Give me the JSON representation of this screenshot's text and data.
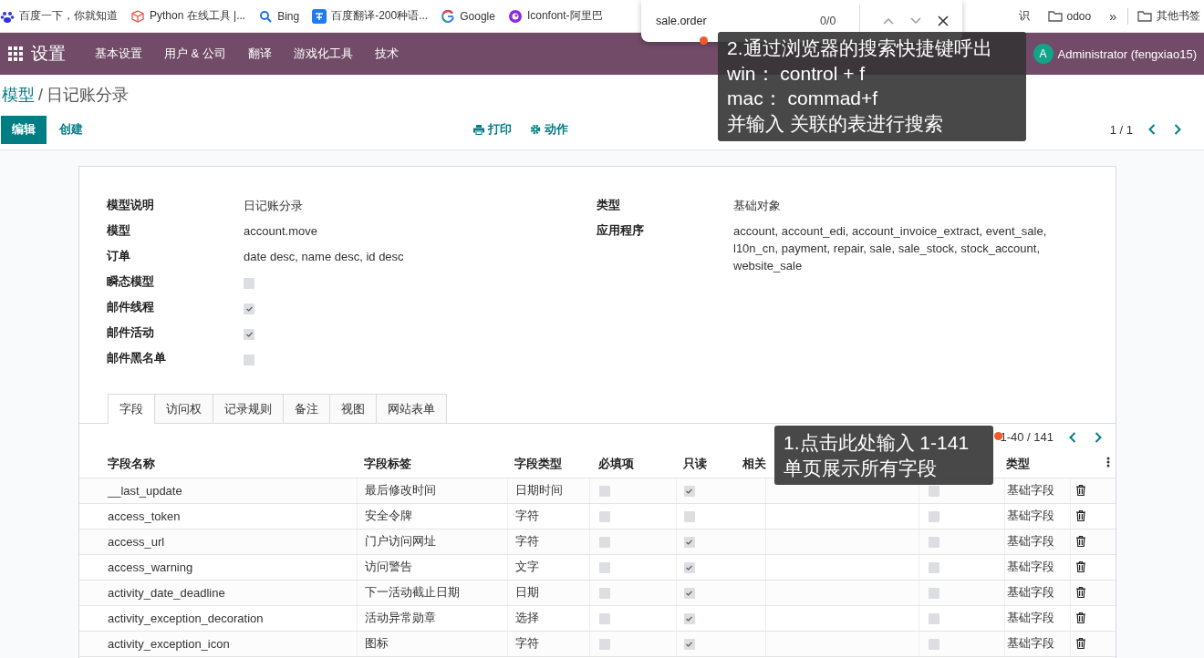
{
  "browser": {
    "bookmarks": [
      {
        "label": "百度一下，你就知道"
      },
      {
        "label": "Python 在线工具 |..."
      },
      {
        "label": "Bing"
      },
      {
        "label": "百度翻译-200种语..."
      },
      {
        "label": "Google"
      },
      {
        "label": "Iconfont-阿里巴"
      }
    ],
    "bookmarks_right": [
      {
        "label": "识"
      },
      {
        "label": "odoo"
      }
    ],
    "overflow": "»",
    "other_bookmarks": "其他书签",
    "find_bar": {
      "value": "sale.order",
      "count": "0/0"
    }
  },
  "navbar": {
    "app": "设置",
    "menus": [
      "基本设置",
      "用户 & 公司",
      "翻译",
      "游戏化工具",
      "技术"
    ],
    "user": {
      "initial": "A",
      "name": "Administrator (fengxiao15)"
    }
  },
  "breadcrumb": {
    "items": [
      "模型",
      "日记账分录"
    ],
    "separator": "/"
  },
  "control_panel": {
    "buttons": [
      "编辑",
      "创建"
    ],
    "actions": [
      "打印",
      "动作"
    ],
    "pager": "1 / 1"
  },
  "form": {
    "left": [
      {
        "label": "模型说明",
        "kind": "text",
        "value": "日记账分录"
      },
      {
        "label": "模型",
        "kind": "text",
        "value": "account.move"
      },
      {
        "label": "订单",
        "kind": "text",
        "value": "date desc, name desc, id desc"
      },
      {
        "label": "瞬态模型",
        "kind": "checkbox",
        "checked": false
      },
      {
        "label": "邮件线程",
        "kind": "checkbox",
        "checked": true
      },
      {
        "label": "邮件活动",
        "kind": "checkbox",
        "checked": true
      },
      {
        "label": "邮件黑名单",
        "kind": "checkbox",
        "checked": false
      }
    ],
    "right": [
      {
        "label": "类型",
        "kind": "text",
        "value": "基础对象"
      },
      {
        "label": "应用程序",
        "kind": "text",
        "value": "account, account_edi, account_invoice_extract, event_sale, l10n_cn, payment, repair, sale, sale_stock, stock_account, website_sale"
      }
    ]
  },
  "tabs": [
    {
      "label": "字段",
      "selected": true
    },
    {
      "label": "访问权",
      "selected": false
    },
    {
      "label": "记录规则",
      "selected": false
    },
    {
      "label": "备注",
      "selected": false
    },
    {
      "label": "视图",
      "selected": false
    },
    {
      "label": "网站表单",
      "selected": false
    }
  ],
  "fields_table": {
    "pager": "1-40 / 141",
    "columns": [
      "字段名称",
      "字段标签",
      "字段类型",
      "必填项",
      "只读",
      "相关",
      "类型"
    ],
    "rows": [
      {
        "name": "__last_update",
        "label": "最后修改时间",
        "type": "日期时间",
        "required": false,
        "readonly": true,
        "column_6": false,
        "field_kind": "基础字段"
      },
      {
        "name": "access_token",
        "label": "安全令牌",
        "type": "字符",
        "required": false,
        "readonly": false,
        "column_6": false,
        "field_kind": "基础字段"
      },
      {
        "name": "access_url",
        "label": "门户访问网址",
        "type": "字符",
        "required": false,
        "readonly": true,
        "column_6": false,
        "field_kind": "基础字段"
      },
      {
        "name": "access_warning",
        "label": "访问警告",
        "type": "文字",
        "required": false,
        "readonly": true,
        "column_6": false,
        "field_kind": "基础字段"
      },
      {
        "name": "activity_date_deadline",
        "label": "下一活动截止日期",
        "type": "日期",
        "required": false,
        "readonly": true,
        "column_6": false,
        "field_kind": "基础字段"
      },
      {
        "name": "activity_exception_decoration",
        "label": "活动异常勋章",
        "type": "选择",
        "required": false,
        "readonly": true,
        "column_6": false,
        "field_kind": "基础字段"
      },
      {
        "name": "activity_exception_icon",
        "label": "图标",
        "type": "字符",
        "required": false,
        "readonly": true,
        "column_6": false,
        "field_kind": "基础字段"
      }
    ]
  },
  "annotations": [
    {
      "lines": [
        "2.通过浏览器的搜索快捷键呼出",
        "win： control + f",
        "mac： commad+f",
        "并输入 关联的表进行搜索"
      ]
    },
    {
      "lines": [
        "1.点击此处输入 1-141",
        "单页展示所有字段"
      ]
    }
  ]
}
